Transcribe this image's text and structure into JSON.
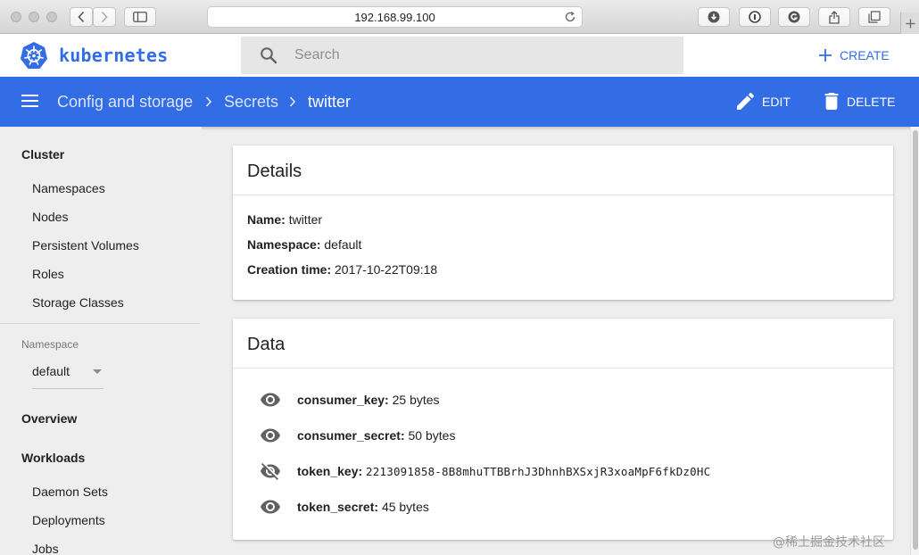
{
  "browser": {
    "url": "192.168.99.100"
  },
  "app": {
    "brand": "kubernetes",
    "search_placeholder": "Search",
    "create_label": "CREATE"
  },
  "toolbar": {
    "breadcrumbs": [
      "Config and storage",
      "Secrets",
      "twitter"
    ],
    "edit_label": "EDIT",
    "delete_label": "DELETE"
  },
  "sidebar": {
    "cluster": {
      "heading": "Cluster",
      "items": [
        "Namespaces",
        "Nodes",
        "Persistent Volumes",
        "Roles",
        "Storage Classes"
      ]
    },
    "namespace": {
      "label": "Namespace",
      "selected": "default"
    },
    "overview": "Overview",
    "workloads": {
      "heading": "Workloads",
      "items": [
        "Daemon Sets",
        "Deployments",
        "Jobs"
      ]
    }
  },
  "details": {
    "title": "Details",
    "fields": [
      {
        "key": "Name:",
        "value": "twitter"
      },
      {
        "key": "Namespace:",
        "value": "default"
      },
      {
        "key": "Creation time:",
        "value": "2017-10-22T09:18"
      }
    ]
  },
  "data": {
    "title": "Data",
    "entries": [
      {
        "key": "consumer_key:",
        "value": "25 bytes",
        "revealed": false
      },
      {
        "key": "consumer_secret:",
        "value": "50 bytes",
        "revealed": false
      },
      {
        "key": "token_key:",
        "value": "2213091858-8B8mhuTTBBrhJ3DhnhBXSxjR3xoaMpF6fkDz0HC",
        "revealed": true
      },
      {
        "key": "token_secret:",
        "value": "45 bytes",
        "revealed": false
      }
    ]
  },
  "watermark": "@稀土掘金技术社区",
  "colors": {
    "brand_blue": "#326de6",
    "sidebar_bg": "#eeeeee",
    "search_bg": "#e6e6e6"
  },
  "icons": {
    "menu": "menu-icon",
    "search": "search-icon",
    "create": "plus-icon",
    "edit": "pencil-icon",
    "delete": "trash-icon",
    "show": "eye-icon",
    "hide": "eye-off-icon"
  }
}
